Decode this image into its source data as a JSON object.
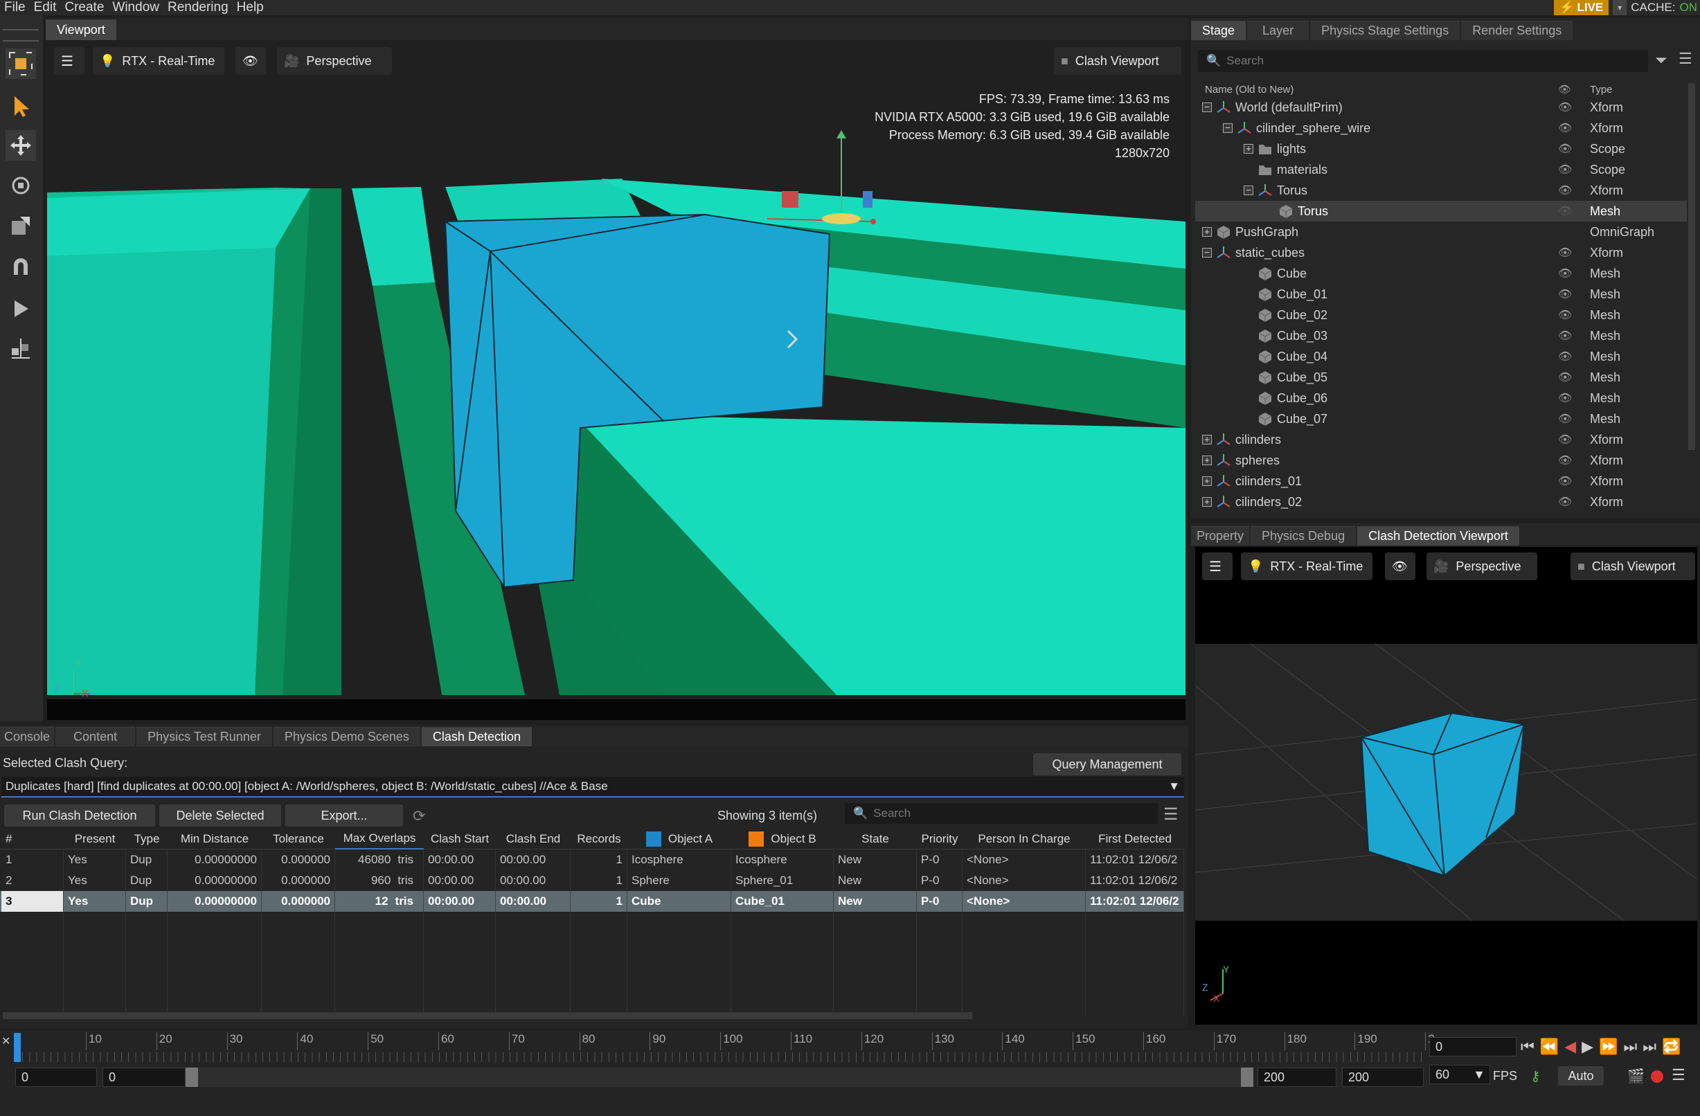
{
  "menu": {
    "items": [
      "File",
      "Edit",
      "Create",
      "Window",
      "Rendering",
      "Help"
    ],
    "live": "LIVE",
    "cache_label": "CACHE:",
    "cache_value": "ON"
  },
  "viewport": {
    "tab": "Viewport",
    "renderer": "RTX - Real-Time",
    "camera": "Perspective",
    "clash_viewport": "Clash Viewport",
    "stats": [
      "FPS: 73.39, Frame time: 13.63 ms",
      "NVIDIA RTX A5000: 3.3 GiB used, 19.6 GiB available",
      "Process Memory: 6.3 GiB used, 39.4 GiB available",
      "1280x720"
    ],
    "axis_z": "Z",
    "axis_y": "Y",
    "axis_x": "X"
  },
  "stage": {
    "tabs": [
      "Stage",
      "Layer",
      "Physics Stage Settings",
      "Render Settings"
    ],
    "search_placeholder": "Search",
    "col_name": "Name (Old to New)",
    "col_type": "Type",
    "rows": [
      {
        "name": "World (defaultPrim)",
        "type": "Xform"
      },
      {
        "name": "cilinder_sphere_wire",
        "type": "Xform"
      },
      {
        "name": "lights",
        "type": "Scope"
      },
      {
        "name": "materials",
        "type": "Scope"
      },
      {
        "name": "Torus",
        "type": "Xform"
      },
      {
        "name": "Torus",
        "type": "Mesh"
      },
      {
        "name": "PushGraph",
        "type": "OmniGraph"
      },
      {
        "name": "static_cubes",
        "type": "Xform"
      },
      {
        "name": "Cube",
        "type": "Mesh"
      },
      {
        "name": "Cube_01",
        "type": "Mesh"
      },
      {
        "name": "Cube_02",
        "type": "Mesh"
      },
      {
        "name": "Cube_03",
        "type": "Mesh"
      },
      {
        "name": "Cube_04",
        "type": "Mesh"
      },
      {
        "name": "Cube_05",
        "type": "Mesh"
      },
      {
        "name": "Cube_06",
        "type": "Mesh"
      },
      {
        "name": "Cube_07",
        "type": "Mesh"
      },
      {
        "name": "cilinders",
        "type": "Xform"
      },
      {
        "name": "spheres",
        "type": "Xform"
      },
      {
        "name": "cilinders_01",
        "type": "Xform"
      },
      {
        "name": "cilinders_02",
        "type": "Xform"
      }
    ]
  },
  "lower_right": {
    "tabs": [
      "Property",
      "Physics Debug",
      "Clash Detection Viewport"
    ],
    "renderer": "RTX - Real-Time",
    "camera": "Perspective",
    "clash_viewport": "Clash Viewport"
  },
  "bottom_tabs": [
    "Console",
    "Content",
    "Physics Test Runner",
    "Physics Demo Scenes",
    "Clash Detection"
  ],
  "clash": {
    "selected_label": "Selected Clash Query:",
    "query_mgmt": "Query Management",
    "query": "Duplicates [hard] [find duplicates at 00:00.00] [object A: /World/spheres, object B: /World/static_cubes] //Ace & Base",
    "run": "Run Clash Detection",
    "delete": "Delete Selected",
    "export": "Export...",
    "showing": "Showing 3 item(s)",
    "search_placeholder": "Search",
    "headers": [
      "#",
      "Present",
      "Type",
      "Min Distance",
      "Tolerance",
      "Max Overlaps",
      "Clash Start",
      "Clash End",
      "Records",
      "Object A",
      "Object B",
      "State",
      "Priority",
      "Person In Charge",
      "First Detected"
    ],
    "rows": [
      {
        "n": "1",
        "present": "Yes",
        "type": "Dup",
        "min": "0.00000000",
        "tol": "0.000000",
        "ov": "46080",
        "unit": "tris",
        "start": "00:00.00",
        "end": "00:00.00",
        "rec": "1",
        "a": "Icosphere",
        "b": "Icosphere",
        "state": "New",
        "pri": "P-0",
        "person": "<None>",
        "first": "11:02:01 12/06/2"
      },
      {
        "n": "2",
        "present": "Yes",
        "type": "Dup",
        "min": "0.00000000",
        "tol": "0.000000",
        "ov": "960",
        "unit": "tris",
        "start": "00:00.00",
        "end": "00:00.00",
        "rec": "1",
        "a": "Sphere",
        "b": "Sphere_01",
        "state": "New",
        "pri": "P-0",
        "person": "<None>",
        "first": "11:02:01 12/06/2"
      },
      {
        "n": "3",
        "present": "Yes",
        "type": "Dup",
        "min": "0.00000000",
        "tol": "0.000000",
        "ov": "12",
        "unit": "tris",
        "start": "00:00.00",
        "end": "00:00.00",
        "rec": "1",
        "a": "Cube",
        "b": "Cube_01",
        "state": "New",
        "pri": "P-0",
        "person": "<None>",
        "first": "11:02:01 12/06/2"
      }
    ],
    "color_a": "#1e88c8",
    "color_b": "#f07c10"
  },
  "timeline": {
    "ticks": [
      "10",
      "20",
      "30",
      "40",
      "50",
      "60",
      "70",
      "80",
      "90",
      "100",
      "110",
      "120",
      "130",
      "140",
      "150",
      "160",
      "170",
      "180",
      "190",
      "2"
    ],
    "current": "0",
    "start": "0",
    "start2": "0",
    "end": "200",
    "end2": "200",
    "fps": "60",
    "fps_label": "FPS",
    "auto": "Auto"
  }
}
